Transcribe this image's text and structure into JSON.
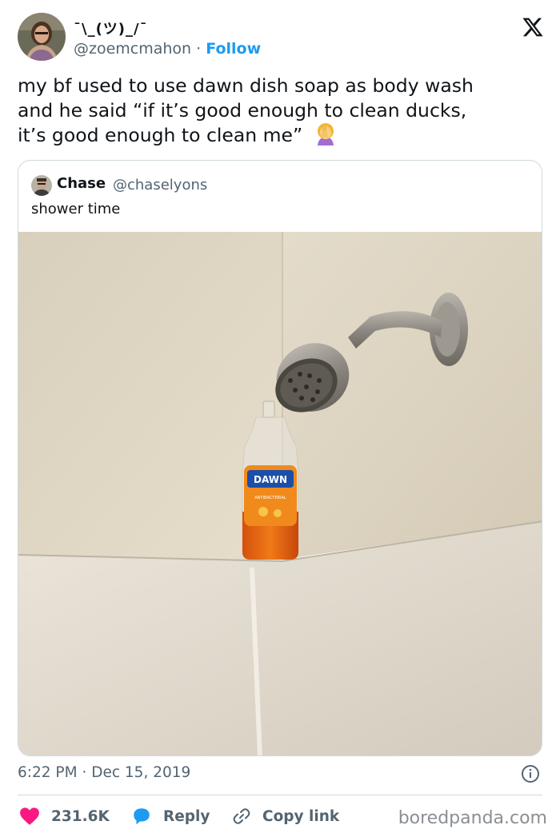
{
  "author": {
    "display_name": "¯\\_(ツ)_/¯",
    "handle": "@zoemcmahon",
    "separator": "·",
    "follow_label": "Follow"
  },
  "tweet": {
    "lines": [
      "my bf used to use dawn dish soap as body wash",
      "and he said “if it’s good enough to clean ducks,",
      "it’s good enough to clean me”"
    ],
    "emoji": "facepalm-emoji"
  },
  "quoted": {
    "name": "Chase",
    "handle": "@chaselyons",
    "text": "shower time",
    "image": "shower-photo",
    "bottle_brand": "DAWN",
    "bottle_subtext": "ANTIBACTERIAL"
  },
  "meta": {
    "time": "6:22 PM",
    "separator": "·",
    "date": "Dec 15, 2019"
  },
  "actions": {
    "like_count": "231.6K",
    "reply_label": "Reply",
    "copy_label": "Copy link"
  },
  "watermark": "boredpanda.com",
  "colors": {
    "follow": "#1d9bf0",
    "like": "#f91880",
    "reply": "#1d9bf0",
    "muted": "#536471"
  }
}
